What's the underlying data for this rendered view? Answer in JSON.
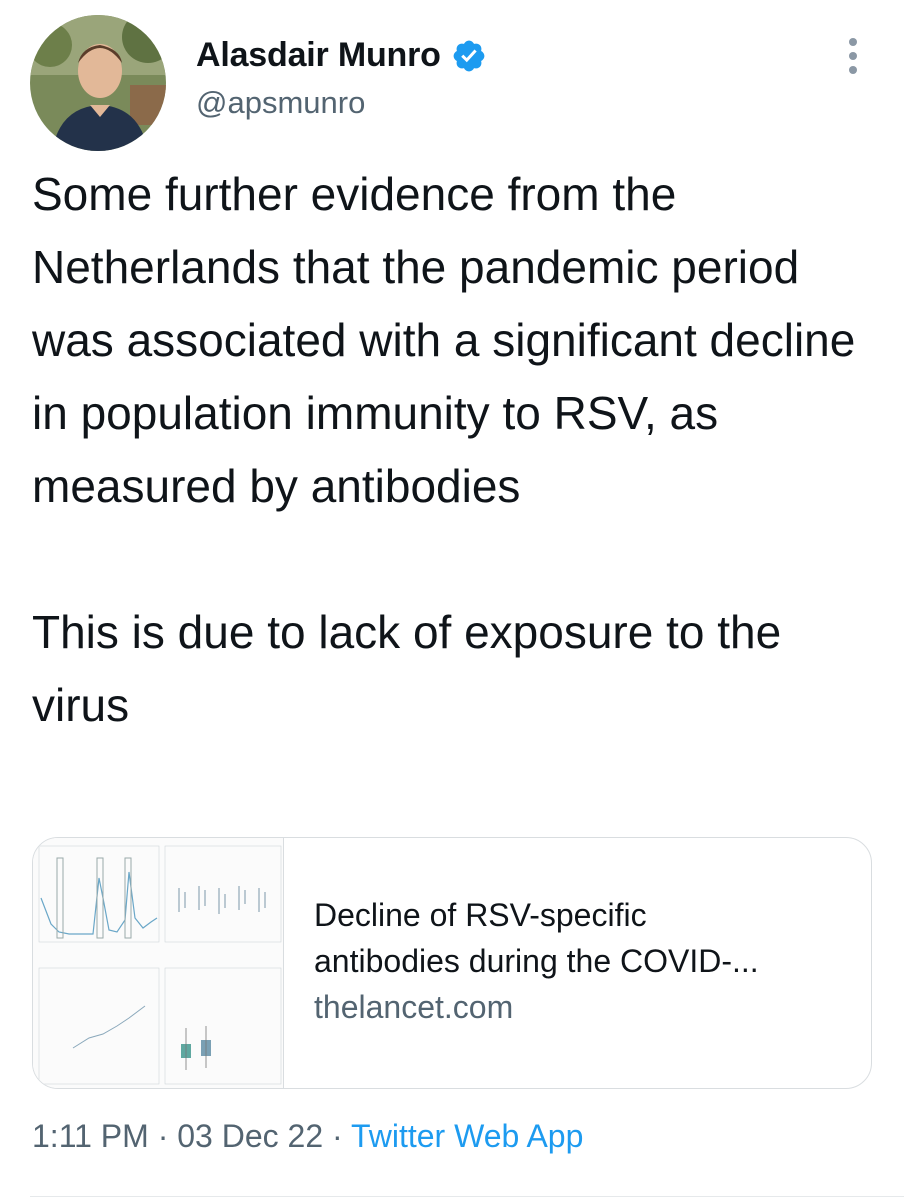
{
  "author": {
    "display_name": "Alasdair Munro",
    "handle": "@apsmunro",
    "verified": true,
    "avatar_icon": "profile-photo"
  },
  "tweet": {
    "paragraphs": [
      "Some further evidence from the Netherlands that the pandemic period was associated with a significant decline in population immunity to RSV, as measured by antibodies",
      "This is due to lack of exposure to the virus"
    ]
  },
  "link_card": {
    "title_line1": "Decline of RSV-specific",
    "title_line2": "antibodies during the COVID-...",
    "domain": "thelancet.com",
    "thumbnail_icon": "article-figure-thumbnail"
  },
  "meta": {
    "time": "1:11 PM",
    "separator": " · ",
    "date": "03 Dec 22",
    "source": "Twitter Web App"
  },
  "colors": {
    "text": "#0f1419",
    "secondary": "#536471",
    "link": "#1d9bf0",
    "verified": "#1d9bf0",
    "border": "#d9dde0"
  },
  "icons": {
    "verified": "verified-badge-icon",
    "more": "more-options-icon"
  }
}
